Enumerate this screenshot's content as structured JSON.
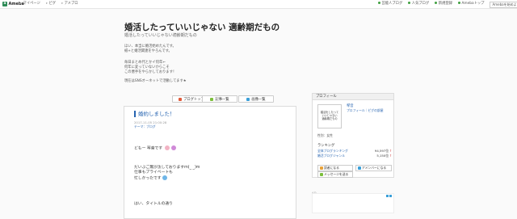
{
  "topbar": {
    "brand_mark": "a",
    "brand_name": "Ameba",
    "nav": [
      "マイページ",
      "ピグ",
      "アメブロ"
    ],
    "right": [
      "芸能人ブログ",
      "人気ブログ",
      "新規登録",
      "Amebaトップ"
    ],
    "right_box": "Amebaを始めよう"
  },
  "blog": {
    "title": "婚活したっていいじゃない 適齢期だもの",
    "subtitle": "婚活したっていいじゃない適齢期だもの",
    "desc_block1": [
      "ほい、本当に婚活始めたんです。",
      "紙+と婚活関連をやろんです。"
    ],
    "desc_block2": [
      "毎日まとめ代とかイ何年←",
      "何年に変っていないからこそ",
      "この悪手をやらかしております！"
    ],
    "desc_block3": [
      "現在はSNSオーネットで活動してます★"
    ]
  },
  "nav_buttons": {
    "top": "ブログトップ",
    "list": "記事一覧",
    "images": "画像一覧"
  },
  "entry": {
    "title": "婚約しました！",
    "date": "2017-11-05 21:00:28",
    "theme": "テーマ：ブログ",
    "line1": "どもー 琴音です",
    "para2": [
      "だいぶご無沙汰しておりますm(_ _)m",
      "仕事もプライベートも",
      "忙しかったです"
    ],
    "line4": "はい、タイトルの通り"
  },
  "sidebar": {
    "head": "プロフィール",
    "avatar_text": [
      "婚活をしたっていいじゃない",
      "適齢期だもの"
    ],
    "name": "琴音",
    "links": "プロフィール｜ピグの部屋",
    "info": "性別：女性",
    "ranking_head": "ランキング",
    "ranking": [
      {
        "label": "全体ブログランキング",
        "value": "94,597位"
      },
      {
        "label": "婚活ブログジャンル",
        "value": "5,150位"
      }
    ],
    "buttons": {
      "reader": "読者になる",
      "amember": "アメンバーになる",
      "message": "メッセージを送る"
    }
  },
  "ad": {
    "label": "AD"
  },
  "colors": {
    "link": "#2563b0",
    "brand": "#2e8b57",
    "rank_arrow": "#c33"
  }
}
